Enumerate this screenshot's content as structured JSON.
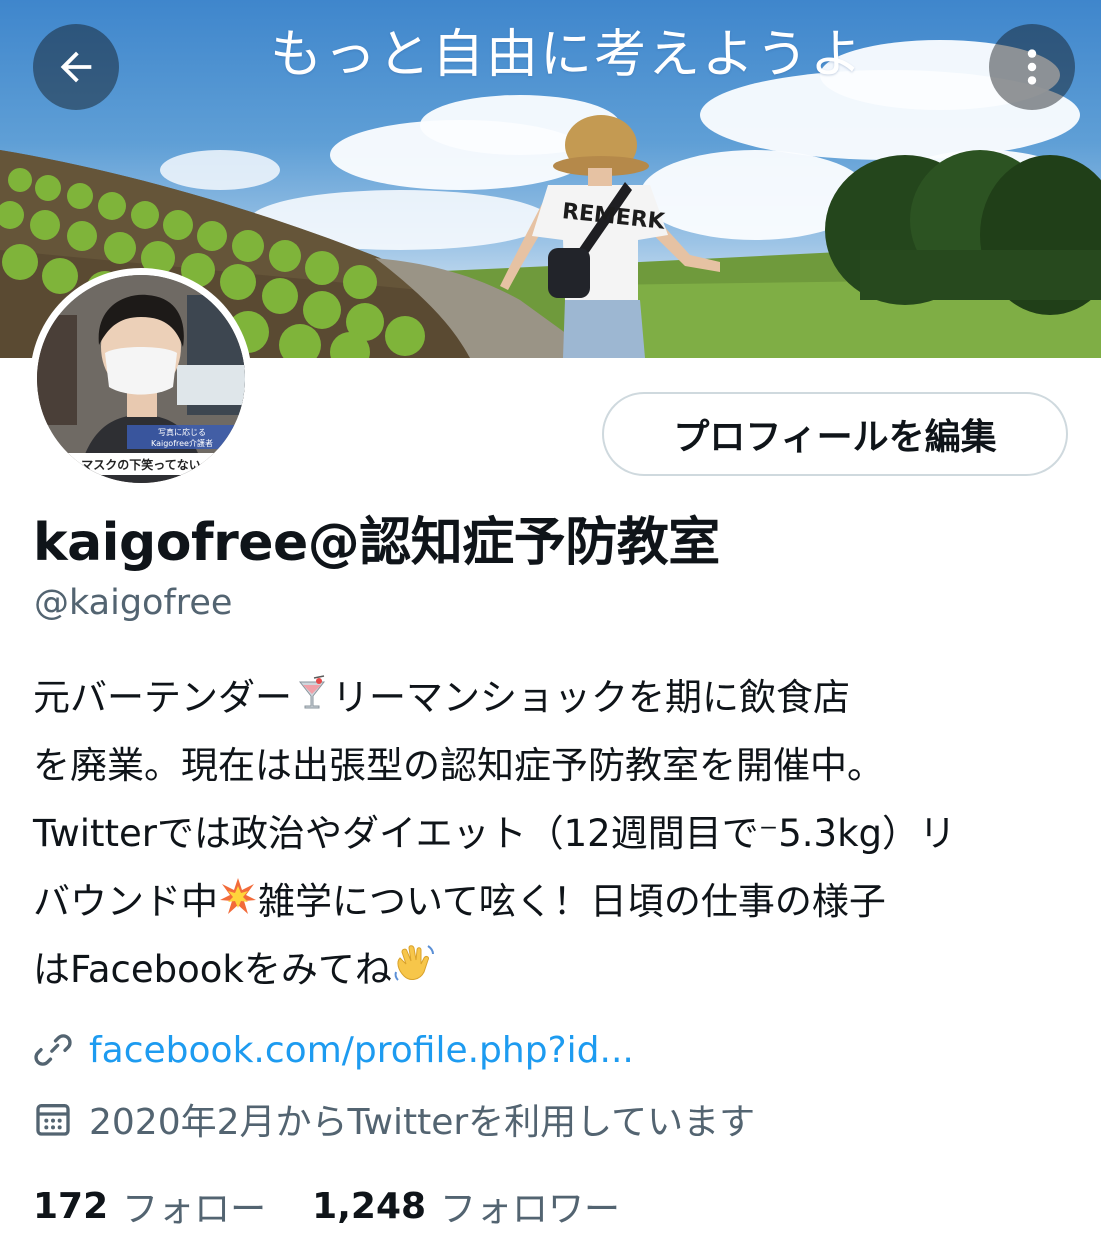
{
  "banner": {
    "title": "もっと自由に考えようよ",
    "shirt_text": "REMERK"
  },
  "header": {
    "back_icon": "arrow-left-icon",
    "more_icon": "more-vertical-icon"
  },
  "avatar": {
    "caption_lines": [
      "写真に応じる",
      "Kaigofree介護者"
    ],
    "caption_banner": "マスクの下笑ってない"
  },
  "profile": {
    "edit_button_label": "プロフィールを編集",
    "display_name": "kaigofree@認知症予防教室",
    "handle": "@kaigofree",
    "bio_lines": [
      {
        "text": "元バーテンダー",
        "emoji": "cocktail",
        "after": "リーマンショックを期に飲食店"
      },
      {
        "text": "を廃業。現在は出張型の認知症予防教室を開催中。"
      },
      {
        "text": "Twitterでは政治やダイエット（12週間目で⁻5.3kg）リ"
      },
      {
        "text": "バウンド中",
        "emoji": "collision",
        "after": "雑学について呟く！日頃の仕事の様子"
      },
      {
        "text": "はFacebookをみてね",
        "emoji": "waving-hand"
      }
    ],
    "link": {
      "icon": "link-icon",
      "text": "facebook.com/profile.php?id..."
    },
    "joined": {
      "icon": "calendar-icon",
      "text": "2020年2月からTwitterを利用しています"
    }
  },
  "stats": {
    "following_count": "172",
    "following_label": "フォロー",
    "followers_count": "1,248",
    "followers_label": "フォロワー"
  },
  "colors": {
    "text_primary": "#0f1419",
    "text_secondary": "#536471",
    "link": "#1d9bf0",
    "border": "#cfd9de"
  }
}
